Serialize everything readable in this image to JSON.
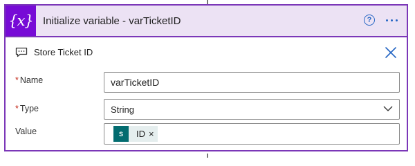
{
  "header": {
    "title": "Initialize variable - varTicketID",
    "icon_text": "{x}",
    "help_glyph": "?",
    "accent_color": "#770bd6",
    "header_bg": "#ece2f4"
  },
  "comment": {
    "label": "Store Ticket ID"
  },
  "fields": {
    "name": {
      "label": "Name",
      "required_mark": "*",
      "value": "varTicketID"
    },
    "type": {
      "label": "Type",
      "required_mark": "*",
      "value": "String"
    },
    "value": {
      "label": "Value",
      "token": {
        "icon_text": "S",
        "label": "ID",
        "remove_glyph": "×",
        "icon_color": "#036c70"
      }
    }
  },
  "icons": {
    "header": "variable-icon",
    "help": "help-icon",
    "more": "more-options-icon",
    "comment": "comment-icon",
    "close": "close-icon",
    "dropdown": "chevron-down-icon",
    "token": "sharepoint-icon"
  }
}
